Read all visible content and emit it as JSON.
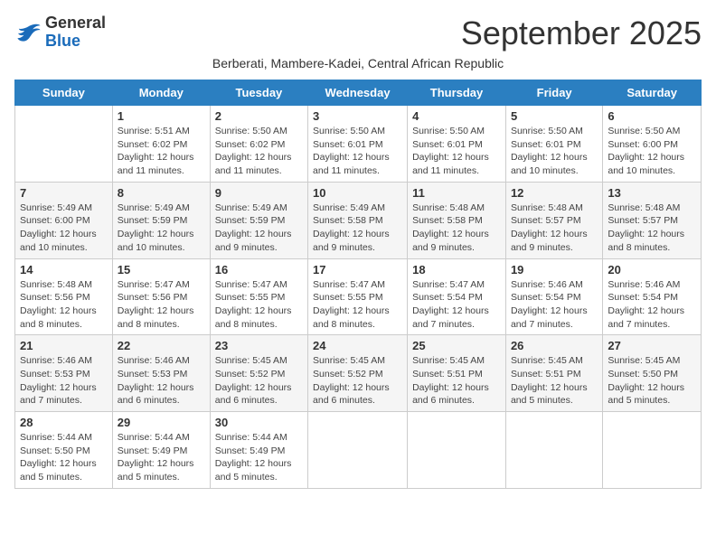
{
  "logo": {
    "general": "General",
    "blue": "Blue"
  },
  "title": "September 2025",
  "subtitle": "Berberati, Mambere-Kadei, Central African Republic",
  "days_of_week": [
    "Sunday",
    "Monday",
    "Tuesday",
    "Wednesday",
    "Thursday",
    "Friday",
    "Saturday"
  ],
  "weeks": [
    [
      {
        "day": "",
        "info": ""
      },
      {
        "day": "1",
        "info": "Sunrise: 5:51 AM\nSunset: 6:02 PM\nDaylight: 12 hours\nand 11 minutes."
      },
      {
        "day": "2",
        "info": "Sunrise: 5:50 AM\nSunset: 6:02 PM\nDaylight: 12 hours\nand 11 minutes."
      },
      {
        "day": "3",
        "info": "Sunrise: 5:50 AM\nSunset: 6:01 PM\nDaylight: 12 hours\nand 11 minutes."
      },
      {
        "day": "4",
        "info": "Sunrise: 5:50 AM\nSunset: 6:01 PM\nDaylight: 12 hours\nand 11 minutes."
      },
      {
        "day": "5",
        "info": "Sunrise: 5:50 AM\nSunset: 6:01 PM\nDaylight: 12 hours\nand 10 minutes."
      },
      {
        "day": "6",
        "info": "Sunrise: 5:50 AM\nSunset: 6:00 PM\nDaylight: 12 hours\nand 10 minutes."
      }
    ],
    [
      {
        "day": "7",
        "info": "Sunrise: 5:49 AM\nSunset: 6:00 PM\nDaylight: 12 hours\nand 10 minutes."
      },
      {
        "day": "8",
        "info": "Sunrise: 5:49 AM\nSunset: 5:59 PM\nDaylight: 12 hours\nand 10 minutes."
      },
      {
        "day": "9",
        "info": "Sunrise: 5:49 AM\nSunset: 5:59 PM\nDaylight: 12 hours\nand 9 minutes."
      },
      {
        "day": "10",
        "info": "Sunrise: 5:49 AM\nSunset: 5:58 PM\nDaylight: 12 hours\nand 9 minutes."
      },
      {
        "day": "11",
        "info": "Sunrise: 5:48 AM\nSunset: 5:58 PM\nDaylight: 12 hours\nand 9 minutes."
      },
      {
        "day": "12",
        "info": "Sunrise: 5:48 AM\nSunset: 5:57 PM\nDaylight: 12 hours\nand 9 minutes."
      },
      {
        "day": "13",
        "info": "Sunrise: 5:48 AM\nSunset: 5:57 PM\nDaylight: 12 hours\nand 8 minutes."
      }
    ],
    [
      {
        "day": "14",
        "info": "Sunrise: 5:48 AM\nSunset: 5:56 PM\nDaylight: 12 hours\nand 8 minutes."
      },
      {
        "day": "15",
        "info": "Sunrise: 5:47 AM\nSunset: 5:56 PM\nDaylight: 12 hours\nand 8 minutes."
      },
      {
        "day": "16",
        "info": "Sunrise: 5:47 AM\nSunset: 5:55 PM\nDaylight: 12 hours\nand 8 minutes."
      },
      {
        "day": "17",
        "info": "Sunrise: 5:47 AM\nSunset: 5:55 PM\nDaylight: 12 hours\nand 8 minutes."
      },
      {
        "day": "18",
        "info": "Sunrise: 5:47 AM\nSunset: 5:54 PM\nDaylight: 12 hours\nand 7 minutes."
      },
      {
        "day": "19",
        "info": "Sunrise: 5:46 AM\nSunset: 5:54 PM\nDaylight: 12 hours\nand 7 minutes."
      },
      {
        "day": "20",
        "info": "Sunrise: 5:46 AM\nSunset: 5:54 PM\nDaylight: 12 hours\nand 7 minutes."
      }
    ],
    [
      {
        "day": "21",
        "info": "Sunrise: 5:46 AM\nSunset: 5:53 PM\nDaylight: 12 hours\nand 7 minutes."
      },
      {
        "day": "22",
        "info": "Sunrise: 5:46 AM\nSunset: 5:53 PM\nDaylight: 12 hours\nand 6 minutes."
      },
      {
        "day": "23",
        "info": "Sunrise: 5:45 AM\nSunset: 5:52 PM\nDaylight: 12 hours\nand 6 minutes."
      },
      {
        "day": "24",
        "info": "Sunrise: 5:45 AM\nSunset: 5:52 PM\nDaylight: 12 hours\nand 6 minutes."
      },
      {
        "day": "25",
        "info": "Sunrise: 5:45 AM\nSunset: 5:51 PM\nDaylight: 12 hours\nand 6 minutes."
      },
      {
        "day": "26",
        "info": "Sunrise: 5:45 AM\nSunset: 5:51 PM\nDaylight: 12 hours\nand 5 minutes."
      },
      {
        "day": "27",
        "info": "Sunrise: 5:45 AM\nSunset: 5:50 PM\nDaylight: 12 hours\nand 5 minutes."
      }
    ],
    [
      {
        "day": "28",
        "info": "Sunrise: 5:44 AM\nSunset: 5:50 PM\nDaylight: 12 hours\nand 5 minutes."
      },
      {
        "day": "29",
        "info": "Sunrise: 5:44 AM\nSunset: 5:49 PM\nDaylight: 12 hours\nand 5 minutes."
      },
      {
        "day": "30",
        "info": "Sunrise: 5:44 AM\nSunset: 5:49 PM\nDaylight: 12 hours\nand 5 minutes."
      },
      {
        "day": "",
        "info": ""
      },
      {
        "day": "",
        "info": ""
      },
      {
        "day": "",
        "info": ""
      },
      {
        "day": "",
        "info": ""
      }
    ]
  ]
}
